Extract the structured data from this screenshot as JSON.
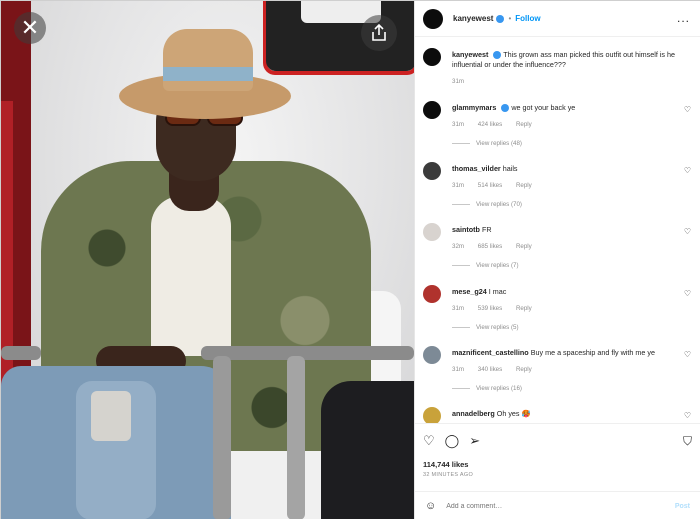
{
  "photo": {
    "close_icon": "close-icon",
    "share_icon": "share-icon"
  },
  "header": {
    "username": "kanyewest",
    "separator": "•",
    "follow_label": "Follow",
    "more_label": "..."
  },
  "caption": {
    "username": "kanyewest",
    "text": "This grown ass man picked this outfit out himself is he influential or under the influence???",
    "time": "31m"
  },
  "comments": [
    {
      "username": "glammymars",
      "text": "we got your back ye",
      "time": "31m",
      "likes": "424 likes",
      "reply": "Reply",
      "replies": "View replies (48)",
      "avatar_color": "#0c0c0c"
    },
    {
      "username": "thomas_vilder",
      "text": "hails",
      "time": "31m",
      "likes": "514 likes",
      "reply": "Reply",
      "replies": "View replies (70)",
      "avatar_color": "#3b3b3b"
    },
    {
      "username": "saintotb",
      "text": "FR",
      "time": "32m",
      "likes": "685 likes",
      "reply": "Reply",
      "replies": "View replies (7)",
      "avatar_color": "#d8d3cf"
    },
    {
      "username": "mese_g24",
      "text": "I mac",
      "time": "31m",
      "likes": "539 likes",
      "reply": "Reply",
      "replies": "View replies (5)",
      "avatar_color": "#b0322d"
    },
    {
      "username": "maznificent_castellino",
      "text": "Buy me a spaceship and fly with me ye",
      "time": "31m",
      "likes": "340 likes",
      "reply": "Reply",
      "replies": "View replies (16)",
      "avatar_color": "#7d8a96"
    },
    {
      "username": "annadelberg",
      "text": "Oh yes 🥵",
      "time": "",
      "likes": "",
      "reply": "",
      "replies": "",
      "avatar_color": "#c9a23a"
    }
  ],
  "actions": {
    "like_icon": "heart-icon",
    "comment_icon": "comment-icon",
    "share_icon": "send-icon",
    "save_icon": "bookmark-icon",
    "likes": "114,744 likes",
    "timestamp": "32 MINUTES AGO"
  },
  "add_comment": {
    "placeholder": "Add a comment…",
    "post_label": "Post",
    "emoji_icon": "emoji-icon"
  },
  "colors": {
    "accent": "#0095f6",
    "verified": "#3897f0",
    "text": "#262626",
    "muted": "#8e8e8e"
  }
}
